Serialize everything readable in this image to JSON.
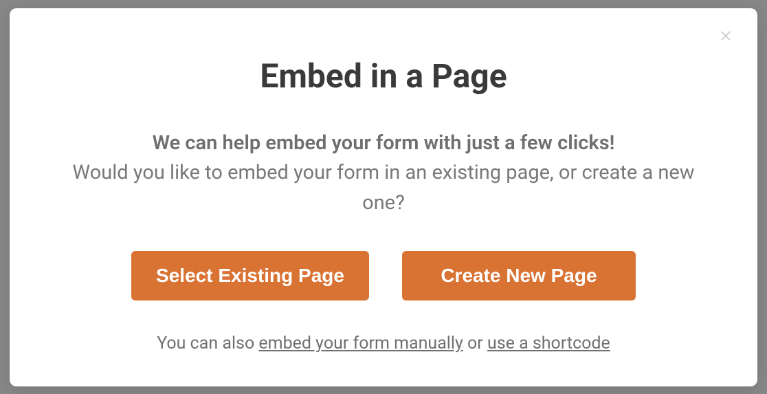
{
  "modal": {
    "title": "Embed in a Page",
    "subtitle": "We can help embed your form with just a few clicks!",
    "description": "Would you like to embed your form in an existing page, or create a new one?",
    "buttons": {
      "existing": "Select Existing Page",
      "create": "Create New Page"
    },
    "footer": {
      "prefix": "You can also ",
      "link1": "embed your form manually",
      "mid": " or ",
      "link2": "use a shortcode"
    }
  }
}
